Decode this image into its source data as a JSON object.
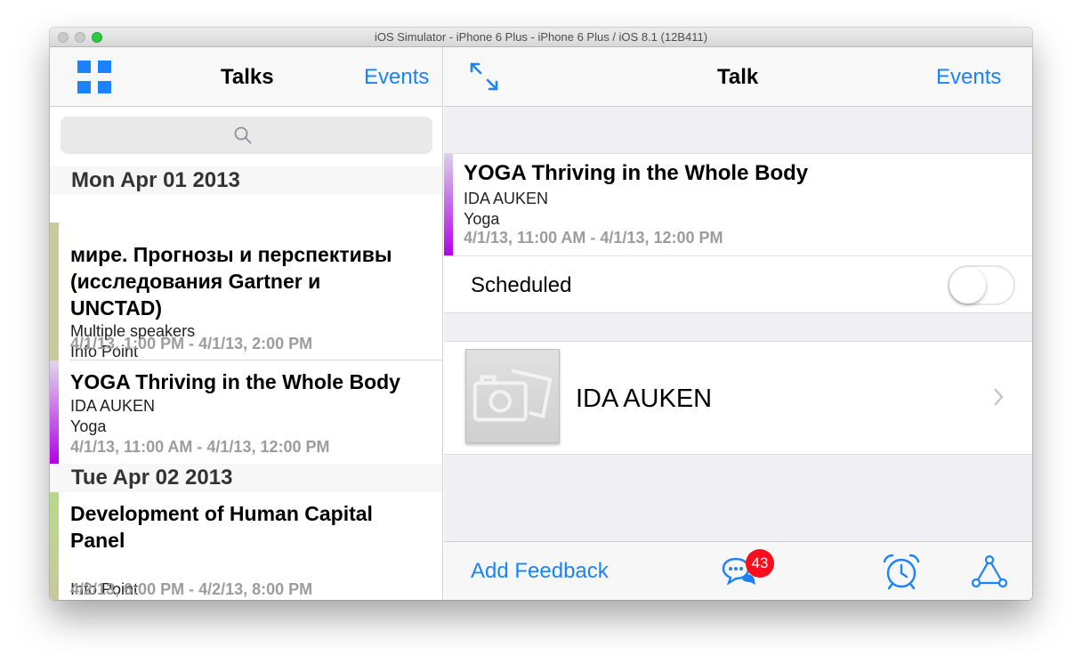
{
  "window": {
    "title": "iOS Simulator - iPhone 6 Plus - iPhone 6 Plus / iOS 8.1 (12B411)"
  },
  "left": {
    "title": "Talks",
    "events_link": "Events",
    "sections": [
      {
        "header": "Mon Apr 01 2013"
      },
      {
        "header": "Tue Apr 02 2013"
      }
    ],
    "rows": [
      {
        "title_lines": [
          "мире. Прогнозы и перспективы",
          "(исследования Gartner и",
          "UNCTAD)"
        ],
        "speaker": "Multiple speakers",
        "location": "Info Point",
        "time": "4/1/13, 1:00 PM - 4/1/13, 2:00 PM",
        "color": "#c9c99a"
      },
      {
        "title": "YOGA Thriving in the Whole Body",
        "speaker": "IDA AUKEN",
        "location": "Yoga",
        "time": "4/1/13, 11:00 AM - 4/1/13, 12:00 PM",
        "color": "#b400e8"
      },
      {
        "title_lines": [
          "Development of Human Capital",
          "Panel"
        ],
        "location": "Info Point",
        "time": "4/2/13, 6:00 PM - 4/2/13, 8:00 PM",
        "color": "#b6d98a"
      }
    ]
  },
  "right": {
    "title": "Talk",
    "events_link": "Events",
    "talk": {
      "title": "YOGA Thriving in the Whole Body",
      "speaker": "IDA AUKEN",
      "location": "Yoga",
      "time": "4/1/13, 11:00 AM - 4/1/13, 12:00 PM"
    },
    "scheduled": {
      "label": "Scheduled",
      "on": false
    },
    "speaker_card": {
      "name": "IDA AUKEN"
    },
    "toolbar": {
      "feedback": "Add Feedback",
      "badge": "43"
    }
  },
  "colors": {
    "accent": "#1a82fb",
    "badge": "#fc0d1b"
  },
  "icons": [
    "grid-icon",
    "search-icon",
    "expand-icon",
    "camera-placeholder-icon",
    "chevron-right-icon",
    "chat-icon",
    "alarm-icon",
    "share-icon"
  ]
}
